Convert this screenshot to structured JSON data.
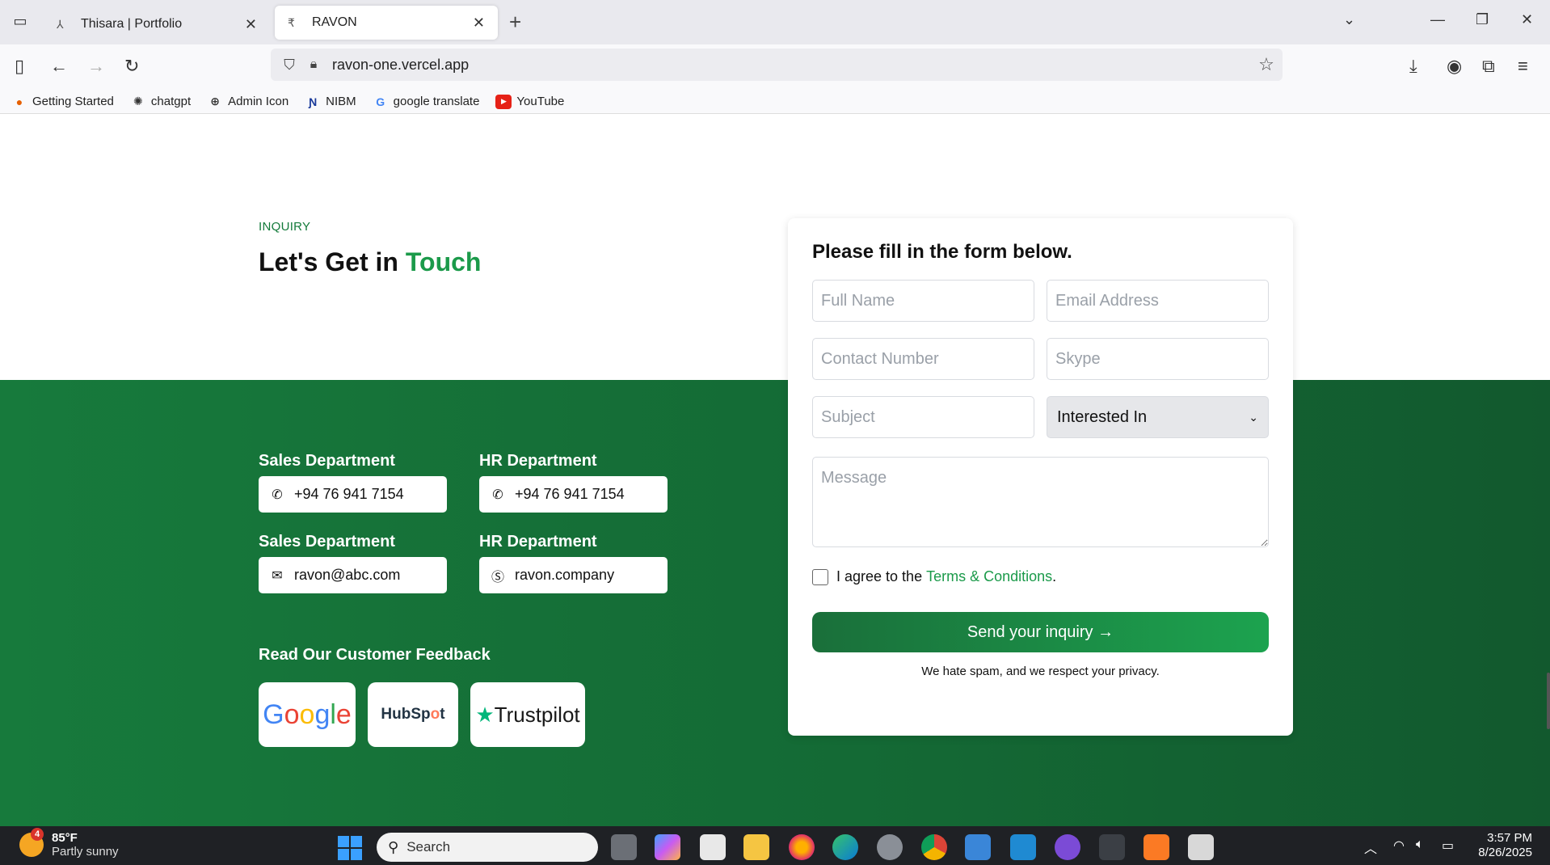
{
  "browser": {
    "tabs": [
      {
        "title": "Thisara | Portfolio",
        "active": false
      },
      {
        "title": "RAVON",
        "active": true
      }
    ],
    "url": "ravon-one.vercel.app",
    "bookmarks": [
      "Getting Started",
      "chatgpt",
      "Admin Icon",
      "NIBM",
      "google translate",
      "YouTube"
    ]
  },
  "page": {
    "eyebrow": "INQUIRY",
    "heading_prefix": "Let's Get in",
    "heading_accent": "Touch",
    "contacts": [
      {
        "label": "Sales Department",
        "value": "+94 76 941 7154",
        "icon": "phone-icon"
      },
      {
        "label": "HR Department",
        "value": "+94 76 941 7154",
        "icon": "phone-icon"
      },
      {
        "label": "Sales Department",
        "value": "ravon@abc.com",
        "icon": "mail-icon"
      },
      {
        "label": "HR Department",
        "value": "ravon.company",
        "icon": "skype-icon"
      }
    ],
    "feedback_label": "Read Our Customer Feedback",
    "feedback_brands": [
      "Google",
      "HubSpot",
      "Trustpilot"
    ]
  },
  "form": {
    "title": "Please fill in the form below.",
    "full_name_placeholder": "Full Name",
    "email_placeholder": "Email Address",
    "contact_placeholder": "Contact Number",
    "skype_placeholder": "Skype",
    "subject_placeholder": "Subject",
    "interested_in": "Interested In",
    "message_placeholder": "Message",
    "agree_text": "I agree to the",
    "terms_link": "Terms & Conditions",
    "agree_suffix": ".",
    "send_label": "Send your inquiry →",
    "privacy_note": "We hate spam, and we respect your privacy."
  },
  "taskbar": {
    "temperature": "85°F",
    "weather": "Partly sunny",
    "weather_badge": "4",
    "search_placeholder": "Search",
    "time": "3:57 PM",
    "date": "8/26/2025"
  },
  "colors": {
    "accent": "#1b9a4a",
    "band": "#177a3c",
    "card_bg": "#ffffff"
  }
}
